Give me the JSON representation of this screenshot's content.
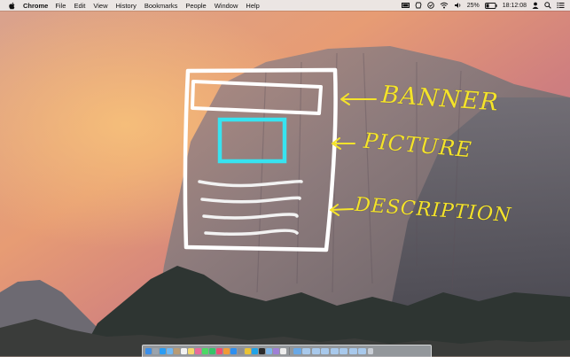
{
  "menubar": {
    "app_name": "Chrome",
    "items": [
      "File",
      "Edit",
      "View",
      "History",
      "Bookmarks",
      "People",
      "Window",
      "Help"
    ],
    "status": {
      "battery_percent": "25%",
      "time": "18:12:08"
    }
  },
  "sketch": {
    "labels": {
      "banner": "BANNER",
      "picture": "PICTURE",
      "description": "DESCRIPTION"
    },
    "stroke_color": "#ffffff",
    "highlight_color": "#37e3f0",
    "label_color": "#f4e32b"
  },
  "dock": {
    "icons": [
      "finder-icon",
      "launchpad-icon",
      "safari-icon",
      "mail-icon",
      "contacts-icon",
      "calendar-icon",
      "notes-icon",
      "photos-icon",
      "messages-icon",
      "facetime-icon",
      "music-icon",
      "books-icon",
      "app-store-icon",
      "preferences-icon",
      "chrome-icon",
      "skype-icon",
      "terminal-icon",
      "folder-icon",
      "preview-icon",
      "textedit-icon",
      "downloads-icon",
      "trash-icon"
    ]
  }
}
